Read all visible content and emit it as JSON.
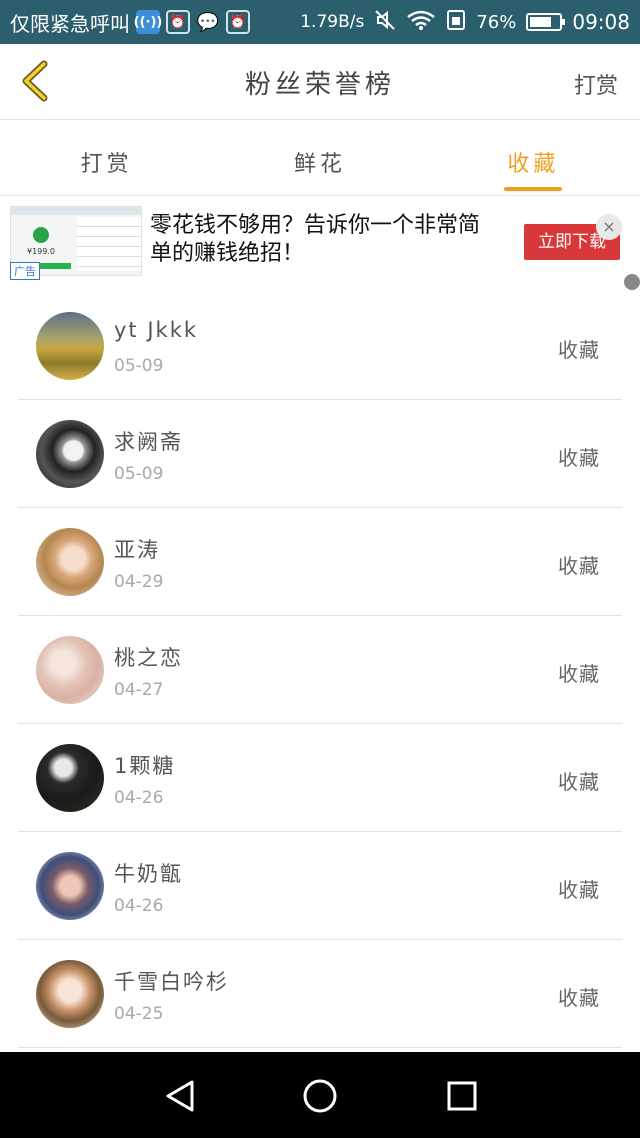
{
  "status_bar": {
    "carrier_text": "仅限紧急呼叫",
    "speed": "1.79B/s",
    "battery_text": "76%",
    "time": "09:08",
    "battery_level": 0.76,
    "icons": [
      "wifi-calling-icon",
      "alarm-icon",
      "wechat-icon",
      "alarm-icon",
      "mute-icon",
      "wifi-icon",
      "sim-icon"
    ]
  },
  "header": {
    "title": "粉丝荣誉榜",
    "action": "打赏"
  },
  "tabs": [
    {
      "label": "打赏",
      "active": false
    },
    {
      "label": "鲜花",
      "active": false
    },
    {
      "label": "收藏",
      "active": true
    }
  ],
  "ad": {
    "tag": "广告",
    "text": "零花钱不够用？告诉你一个非常简单的赚钱绝招！",
    "button": "立即下载",
    "thumb_price": "¥199.0",
    "close_glyph": "×"
  },
  "list": [
    {
      "name": "yt Jkkk",
      "date": "05-09",
      "action": "收藏",
      "avatar": "landscape"
    },
    {
      "name": "求阙斋",
      "date": "05-09",
      "action": "收藏",
      "avatar": "mask"
    },
    {
      "name": "亚涛",
      "date": "04-29",
      "action": "收藏",
      "avatar": "woman"
    },
    {
      "name": "桃之恋",
      "date": "04-27",
      "action": "收藏",
      "avatar": "flowers"
    },
    {
      "name": "1颗糖",
      "date": "04-26",
      "action": "收藏",
      "avatar": "man"
    },
    {
      "name": "牛奶甑",
      "date": "04-26",
      "action": "收藏",
      "avatar": "couple"
    },
    {
      "name": "千雪白吟杉",
      "date": "04-25",
      "action": "收藏",
      "avatar": "anime"
    }
  ],
  "colors": {
    "accent": "#f0a020",
    "status_bar": "#2b5f6e",
    "ad_button": "#d9383a"
  }
}
